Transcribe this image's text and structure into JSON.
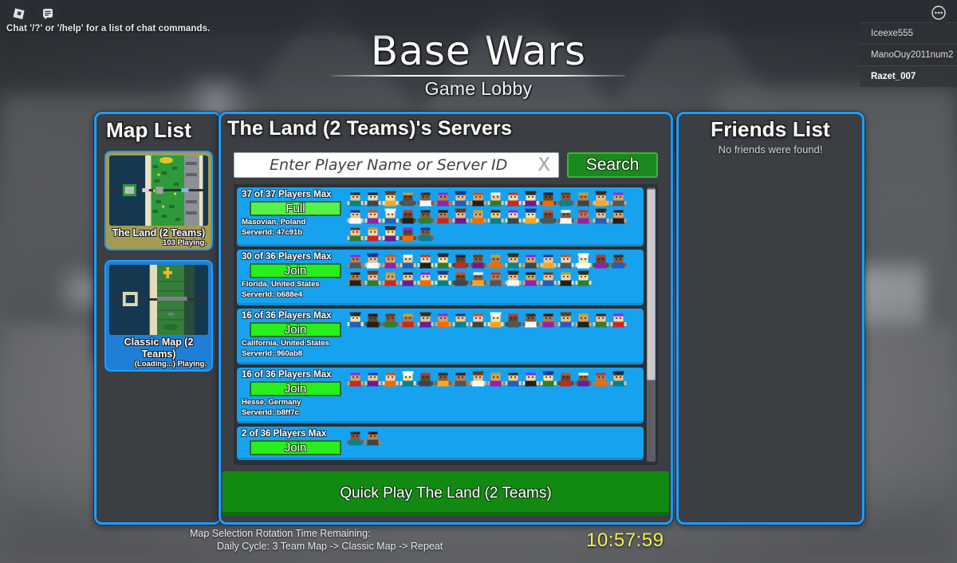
{
  "topbar": {
    "chat_hint": "Chat '/?' or '/help' for a list of chat commands.",
    "roblox_icon": "roblox-logo-icon",
    "chat_icon": "chat-bubble-icon",
    "menu_icon": "more-options-icon"
  },
  "player_list": [
    {
      "name": "Iceexe555",
      "is_local": false
    },
    {
      "name": "ManoOuy2011num2",
      "is_local": false
    },
    {
      "name": "Razet_007",
      "is_local": true
    }
  ],
  "title": {
    "main": "Base Wars",
    "subtitle": "Game Lobby"
  },
  "map_list": {
    "heading": "Map List",
    "maps": [
      {
        "name": "The Land (2 Teams)",
        "count_label": "103 Playing.",
        "selected": true
      },
      {
        "name": "Classic Map (2 Teams)",
        "count_label": "(Loading...) Playing.",
        "selected": false
      }
    ]
  },
  "servers": {
    "heading": "The Land (2 Teams)'s Servers",
    "search": {
      "placeholder": "Enter Player Name or Server ID",
      "value": "",
      "clear_label": "X",
      "button_label": "Search"
    },
    "rows": [
      {
        "capacity": "37 of 37 Players Max",
        "action": "Full",
        "action_state": "full",
        "location": "Masovian, Poland",
        "server_id": "ServerId: 47c91b",
        "avatar_count": 37
      },
      {
        "capacity": "30 of 36 Players Max",
        "action": "Join",
        "action_state": "join",
        "location": "Florida, United States",
        "server_id": "ServerId: b688e4",
        "avatar_count": 30
      },
      {
        "capacity": "16 of 36 Players Max",
        "action": "Join",
        "action_state": "join",
        "location": "California, United States",
        "server_id": "ServerId: 960ab8",
        "avatar_count": 16
      },
      {
        "capacity": "16 of 36 Players Max",
        "action": "Join",
        "action_state": "join",
        "location": "Hesse, Germany",
        "server_id": "ServerId: b8ff7c",
        "avatar_count": 16
      },
      {
        "capacity": "2 of 36 Players Max",
        "action": "Join",
        "action_state": "join",
        "location": "",
        "server_id": "",
        "avatar_count": 2
      }
    ],
    "quick_play_label": "Quick Play The Land (2 Teams)"
  },
  "friends": {
    "heading": "Friends List",
    "empty_message": "No friends were found!"
  },
  "rotation": {
    "line1": "Map Selection Rotation Time Remaining:",
    "line2": "Daily Cycle: 3 Team Map -> Classic Map -> Repeat",
    "timer": "10:57:59"
  },
  "colors": {
    "panel_border": "#1e9eff",
    "panel_bg": "#3b3e43",
    "server_row": "#17a2f0",
    "join_green": "#27ef1c",
    "full_green": "#55f24a",
    "search_green": "#1a8a1f",
    "quickplay_green": "#128a12",
    "timer_yellow": "#f2f24a",
    "map_selected": "#a39b4f",
    "map_unselected": "#1f7fd6"
  }
}
